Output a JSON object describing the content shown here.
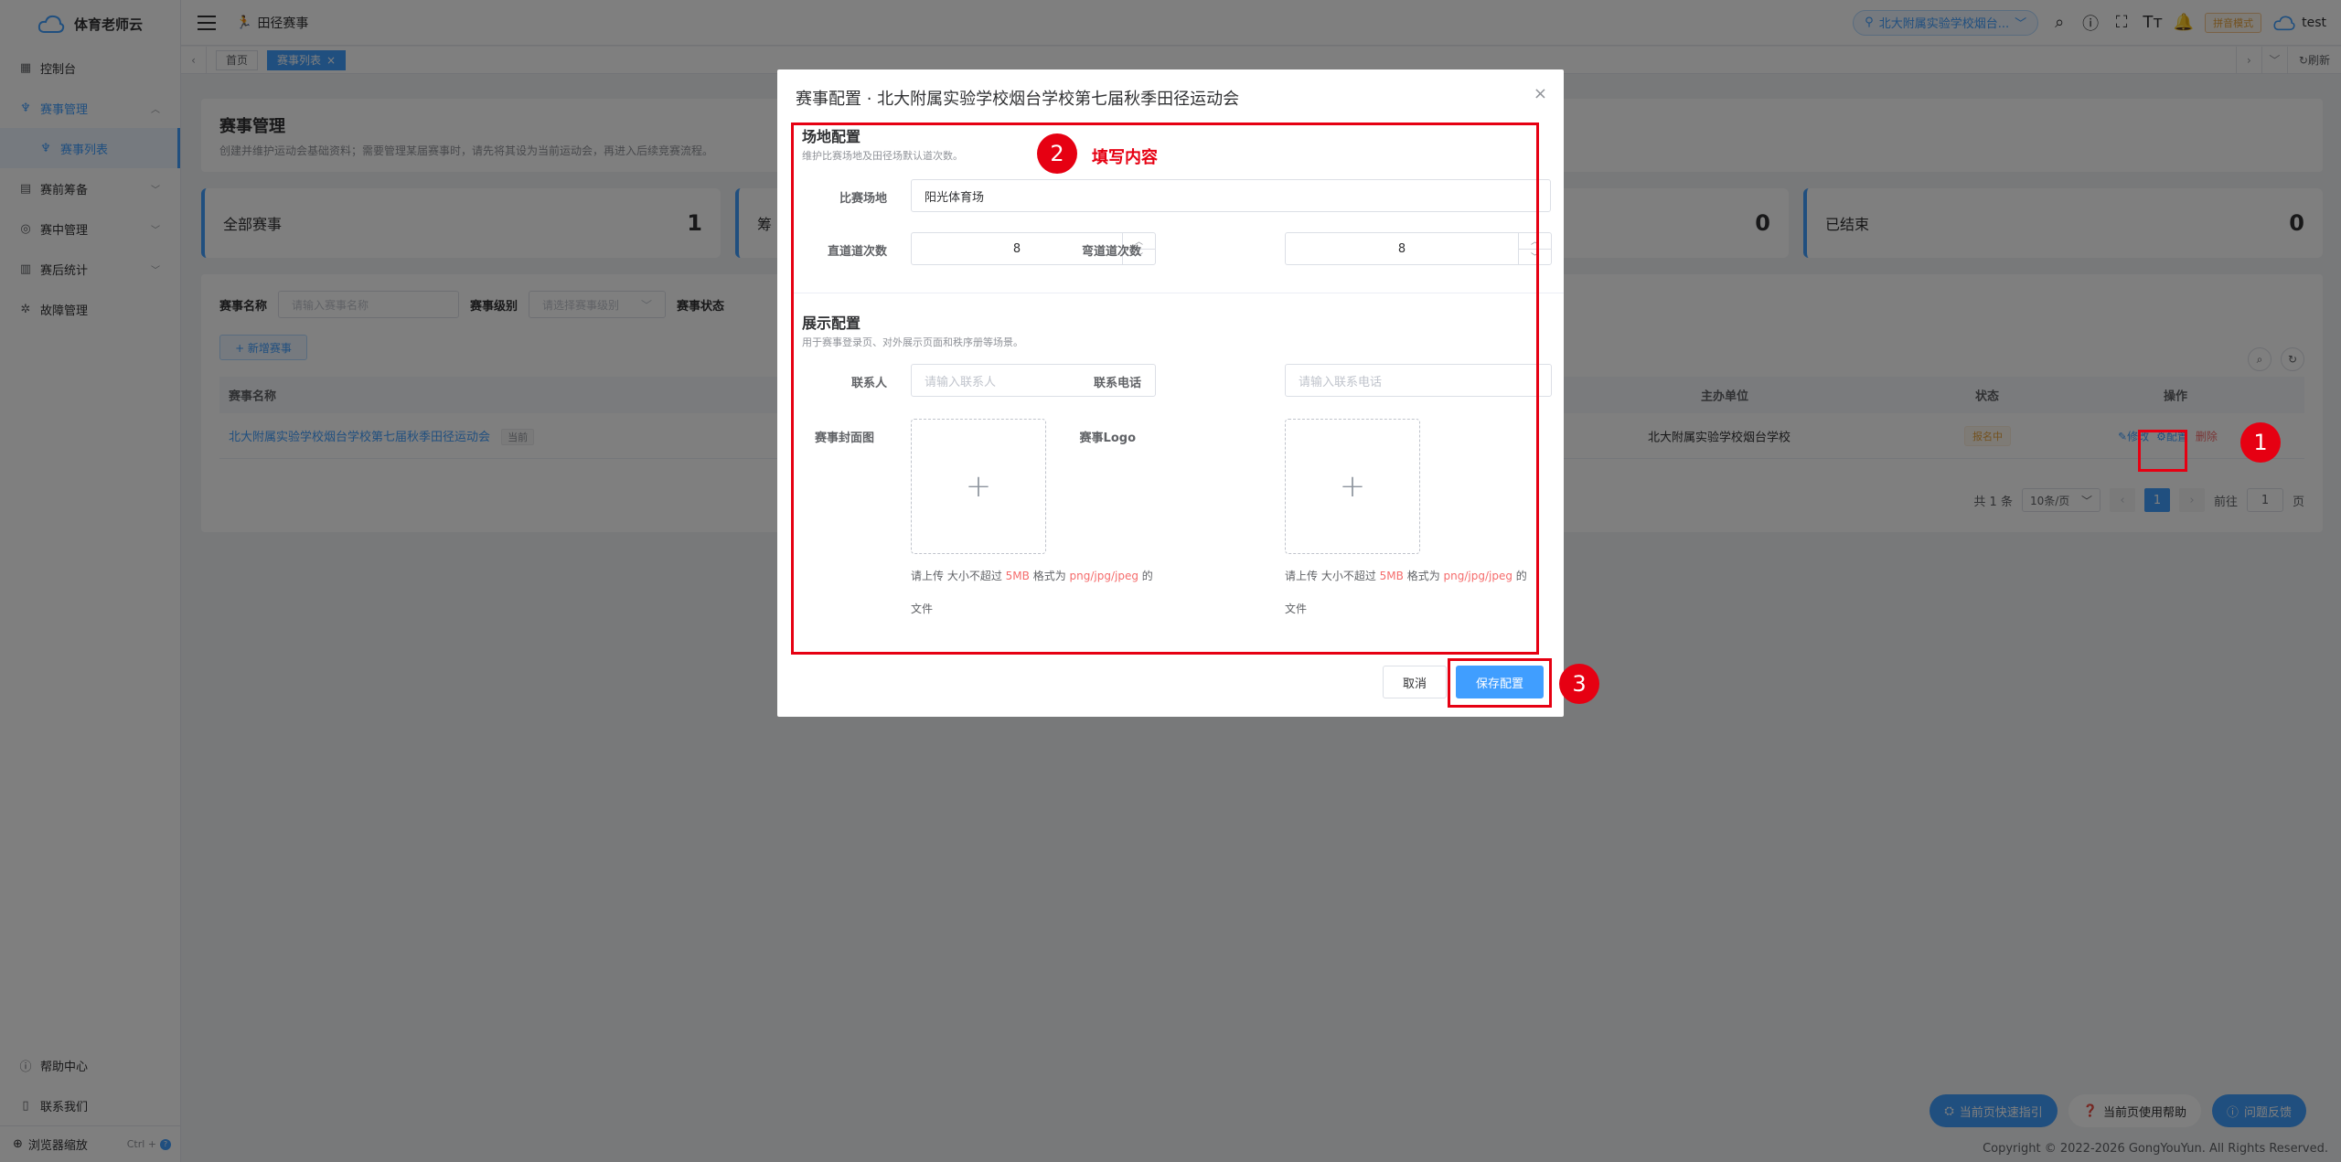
{
  "app": {
    "name": "体育老师云"
  },
  "sidebar": {
    "items": [
      {
        "label": "控制台",
        "icon": "dashboard-icon"
      },
      {
        "label": "赛事管理",
        "icon": "trophy-icon"
      },
      {
        "label": "赛事列表",
        "icon": "trophy-icon"
      },
      {
        "label": "赛前筹备",
        "icon": "file-icon"
      },
      {
        "label": "赛中管理",
        "icon": "compass-icon"
      },
      {
        "label": "赛后统计",
        "icon": "chart-icon"
      },
      {
        "label": "故障管理",
        "icon": "bug-icon"
      }
    ],
    "bottom": {
      "help": "帮助中心",
      "contact": "联系我们",
      "zoom": "浏览器缩放",
      "zoom_kbd": "Ctrl +"
    }
  },
  "header": {
    "breadcrumb": "田径赛事",
    "school": "北大附属实验学校烟台...",
    "mode": "拼音模式",
    "user": "test"
  },
  "tabs": [
    {
      "label": "首页"
    },
    {
      "label": "赛事列表",
      "close": "×"
    }
  ],
  "tabs_refresh": "刷新",
  "page": {
    "title": "赛事管理",
    "subtitle": "创建并维护运动会基础资料；需要管理某届赛事时，请先将其设为当前运动会，再进入后续竞赛流程。"
  },
  "stats": [
    {
      "label": "全部赛事",
      "value": "1"
    },
    {
      "label": "筹",
      "value": ""
    },
    {
      "label": "",
      "value": "0"
    },
    {
      "label": "已结束",
      "value": "0"
    }
  ],
  "filters": {
    "name_label": "赛事名称",
    "name_placeholder": "请输入赛事名称",
    "level_label": "赛事级别",
    "level_placeholder": "请选择赛事级别",
    "status_label": "赛事状态"
  },
  "add_button": "+ 新增赛事",
  "table": {
    "headers": [
      "赛事名称",
      "主办单位",
      "状态",
      "操作"
    ],
    "rows": [
      {
        "name": "北大附属实验学校烟台学校第七届秋季田径运动会",
        "tag": "当前",
        "organizer": "北大附属实验学校烟台学校",
        "status": "报名中",
        "ops": [
          "修改",
          "配置",
          "删除"
        ]
      }
    ]
  },
  "pager": {
    "total": "共 1 条",
    "size": "10条/页",
    "current": "1",
    "goto_label": "前往",
    "goto_value": "1",
    "page_suffix": "页"
  },
  "footer": {
    "copyright": "Copyright © 2022-2026 GongYouYun. All Rights Reserved."
  },
  "float_buttons": [
    "当前页快速指引",
    "当前页使用帮助",
    "问题反馈"
  ],
  "modal": {
    "title": "赛事配置 · 北大附属实验学校烟台学校第七届秋季田径运动会",
    "close": "×",
    "venue_section": {
      "title": "场地配置",
      "subtitle": "维护比赛场地及田径场默认道次数。",
      "venue_label": "比赛场地",
      "venue_value": "阳光体育场",
      "straight_label": "直道道次数",
      "straight_value": "8",
      "curve_label": "弯道道次数",
      "curve_value": "8"
    },
    "display_section": {
      "title": "展示配置",
      "subtitle": "用于赛事登录页、对外展示页面和秩序册等场景。",
      "contact_label": "联系人",
      "contact_placeholder": "请输入联系人",
      "phone_label": "联系电话",
      "phone_placeholder": "请输入联系电话",
      "cover_label": "赛事封面图",
      "logo_label": "赛事Logo",
      "tip_prefix": "请上传 大小不超过 ",
      "tip_size": "5MB",
      "tip_mid": " 格式为 ",
      "tip_format": "png/jpg/jpeg",
      "tip_suffix": " 的",
      "tip_line2": "文件"
    },
    "cancel": "取消",
    "save": "保存配置"
  },
  "annotations": {
    "badge1": "1",
    "badge2": "2",
    "badge3": "3",
    "note2": "填写内容"
  },
  "colors": {
    "primary": "#409eff",
    "annotation": "#e60012",
    "danger": "#f56c6c",
    "warning": "#e6a23c"
  }
}
